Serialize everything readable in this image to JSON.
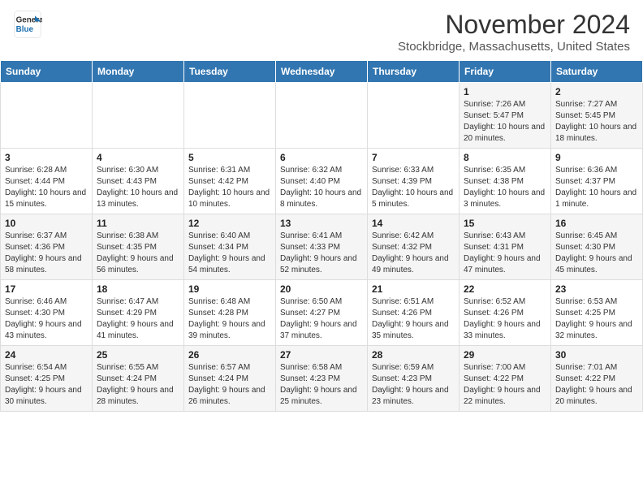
{
  "header": {
    "logo_line1": "General",
    "logo_line2": "Blue",
    "month": "November 2024",
    "location": "Stockbridge, Massachusetts, United States"
  },
  "weekdays": [
    "Sunday",
    "Monday",
    "Tuesday",
    "Wednesday",
    "Thursday",
    "Friday",
    "Saturday"
  ],
  "weeks": [
    [
      {
        "day": "",
        "info": ""
      },
      {
        "day": "",
        "info": ""
      },
      {
        "day": "",
        "info": ""
      },
      {
        "day": "",
        "info": ""
      },
      {
        "day": "",
        "info": ""
      },
      {
        "day": "1",
        "info": "Sunrise: 7:26 AM\nSunset: 5:47 PM\nDaylight: 10 hours and 20 minutes."
      },
      {
        "day": "2",
        "info": "Sunrise: 7:27 AM\nSunset: 5:45 PM\nDaylight: 10 hours and 18 minutes."
      }
    ],
    [
      {
        "day": "3",
        "info": "Sunrise: 6:28 AM\nSunset: 4:44 PM\nDaylight: 10 hours and 15 minutes."
      },
      {
        "day": "4",
        "info": "Sunrise: 6:30 AM\nSunset: 4:43 PM\nDaylight: 10 hours and 13 minutes."
      },
      {
        "day": "5",
        "info": "Sunrise: 6:31 AM\nSunset: 4:42 PM\nDaylight: 10 hours and 10 minutes."
      },
      {
        "day": "6",
        "info": "Sunrise: 6:32 AM\nSunset: 4:40 PM\nDaylight: 10 hours and 8 minutes."
      },
      {
        "day": "7",
        "info": "Sunrise: 6:33 AM\nSunset: 4:39 PM\nDaylight: 10 hours and 5 minutes."
      },
      {
        "day": "8",
        "info": "Sunrise: 6:35 AM\nSunset: 4:38 PM\nDaylight: 10 hours and 3 minutes."
      },
      {
        "day": "9",
        "info": "Sunrise: 6:36 AM\nSunset: 4:37 PM\nDaylight: 10 hours and 1 minute."
      }
    ],
    [
      {
        "day": "10",
        "info": "Sunrise: 6:37 AM\nSunset: 4:36 PM\nDaylight: 9 hours and 58 minutes."
      },
      {
        "day": "11",
        "info": "Sunrise: 6:38 AM\nSunset: 4:35 PM\nDaylight: 9 hours and 56 minutes."
      },
      {
        "day": "12",
        "info": "Sunrise: 6:40 AM\nSunset: 4:34 PM\nDaylight: 9 hours and 54 minutes."
      },
      {
        "day": "13",
        "info": "Sunrise: 6:41 AM\nSunset: 4:33 PM\nDaylight: 9 hours and 52 minutes."
      },
      {
        "day": "14",
        "info": "Sunrise: 6:42 AM\nSunset: 4:32 PM\nDaylight: 9 hours and 49 minutes."
      },
      {
        "day": "15",
        "info": "Sunrise: 6:43 AM\nSunset: 4:31 PM\nDaylight: 9 hours and 47 minutes."
      },
      {
        "day": "16",
        "info": "Sunrise: 6:45 AM\nSunset: 4:30 PM\nDaylight: 9 hours and 45 minutes."
      }
    ],
    [
      {
        "day": "17",
        "info": "Sunrise: 6:46 AM\nSunset: 4:30 PM\nDaylight: 9 hours and 43 minutes."
      },
      {
        "day": "18",
        "info": "Sunrise: 6:47 AM\nSunset: 4:29 PM\nDaylight: 9 hours and 41 minutes."
      },
      {
        "day": "19",
        "info": "Sunrise: 6:48 AM\nSunset: 4:28 PM\nDaylight: 9 hours and 39 minutes."
      },
      {
        "day": "20",
        "info": "Sunrise: 6:50 AM\nSunset: 4:27 PM\nDaylight: 9 hours and 37 minutes."
      },
      {
        "day": "21",
        "info": "Sunrise: 6:51 AM\nSunset: 4:26 PM\nDaylight: 9 hours and 35 minutes."
      },
      {
        "day": "22",
        "info": "Sunrise: 6:52 AM\nSunset: 4:26 PM\nDaylight: 9 hours and 33 minutes."
      },
      {
        "day": "23",
        "info": "Sunrise: 6:53 AM\nSunset: 4:25 PM\nDaylight: 9 hours and 32 minutes."
      }
    ],
    [
      {
        "day": "24",
        "info": "Sunrise: 6:54 AM\nSunset: 4:25 PM\nDaylight: 9 hours and 30 minutes."
      },
      {
        "day": "25",
        "info": "Sunrise: 6:55 AM\nSunset: 4:24 PM\nDaylight: 9 hours and 28 minutes."
      },
      {
        "day": "26",
        "info": "Sunrise: 6:57 AM\nSunset: 4:24 PM\nDaylight: 9 hours and 26 minutes."
      },
      {
        "day": "27",
        "info": "Sunrise: 6:58 AM\nSunset: 4:23 PM\nDaylight: 9 hours and 25 minutes."
      },
      {
        "day": "28",
        "info": "Sunrise: 6:59 AM\nSunset: 4:23 PM\nDaylight: 9 hours and 23 minutes."
      },
      {
        "day": "29",
        "info": "Sunrise: 7:00 AM\nSunset: 4:22 PM\nDaylight: 9 hours and 22 minutes."
      },
      {
        "day": "30",
        "info": "Sunrise: 7:01 AM\nSunset: 4:22 PM\nDaylight: 9 hours and 20 minutes."
      }
    ]
  ]
}
